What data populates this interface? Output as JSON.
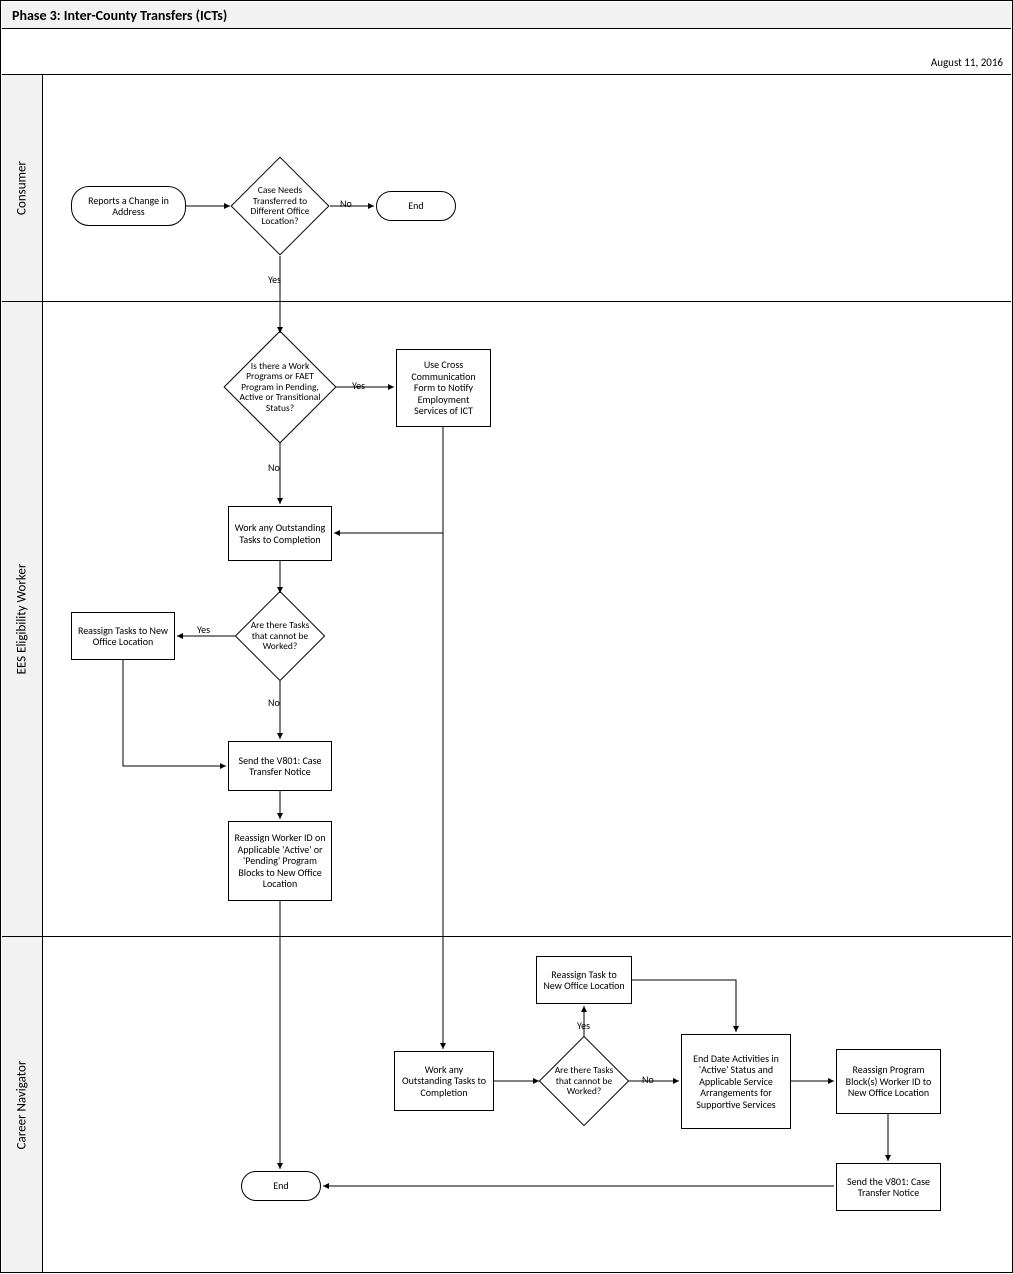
{
  "header": {
    "title": "Phase 3: Inter-County Transfers (ICTs)",
    "date": "August 11, 2016"
  },
  "lanes": {
    "consumer": "Consumer",
    "ees": "EES Eligibility Worker",
    "career": "Career Navigator"
  },
  "nodes": {
    "report_change": "Reports a Change in Address",
    "case_transfer_q": "Case Needs Transferred to Different Office Location?",
    "end1": "End",
    "work_prog_q": "Is there a Work Programs or FAET Program in Pending, Active or Transitional Status?",
    "cross_comm": "Use Cross Communication Form to Notify Employment Services of ICT",
    "work_tasks1": "Work any Outstanding Tasks to Completion",
    "tasks_q1": "Are there Tasks that cannot be Worked?",
    "reassign_tasks1": "Reassign Tasks to New Office Location",
    "send_v801_1": "Send the V801: Case Transfer Notice",
    "reassign_worker": "Reassign Worker ID on Applicable 'Active' or 'Pending' Program Blocks to New Office Location",
    "work_tasks2": "Work any Outstanding Tasks to Completion",
    "tasks_q2": "Are there Tasks that cannot be Worked?",
    "reassign_task2": "Reassign Task to New Office Location",
    "end_date_act": "End Date Activities in 'Active' Status and Applicable Service Arrangements for Supportive Services",
    "reassign_prog": "Reassign Program Block(s) Worker ID to New Office Location",
    "send_v801_2": "Send the V801: Case Transfer Notice",
    "end2": "End"
  },
  "labels": {
    "yes": "Yes",
    "no": "No"
  }
}
